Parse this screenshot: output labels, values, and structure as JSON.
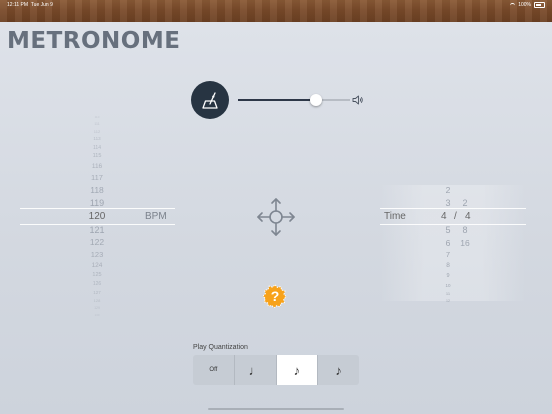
{
  "status_bar": {
    "time": "12:11 PM",
    "date": "Tue Jun 9",
    "battery": "100%"
  },
  "app": {
    "title": "METRONOME"
  },
  "volume": {
    "level": 0.7
  },
  "bpm_picker": {
    "values_above": [
      "110",
      "111",
      "112",
      "113",
      "114",
      "115",
      "116",
      "117",
      "118",
      "119"
    ],
    "selected": "120",
    "values_below": [
      "121",
      "122",
      "123",
      "124",
      "125",
      "126",
      "127",
      "128",
      "129",
      "130"
    ],
    "unit": "BPM"
  },
  "time_signature": {
    "label": "Time",
    "beats_above": [
      "2",
      "3"
    ],
    "beats_selected": "4",
    "beats_below": [
      "5",
      "6",
      "7",
      "8",
      "9",
      "10",
      "11",
      "12"
    ],
    "separator": "/",
    "note_above": [
      "2"
    ],
    "note_selected": "4",
    "note_below": [
      "8",
      "16"
    ]
  },
  "help": {
    "label": "?",
    "color": "#f7a21b"
  },
  "quantization": {
    "label": "Play Quantization",
    "options": [
      {
        "label": "Off",
        "icon": "off"
      },
      {
        "label": "♩",
        "icon": "quarter-note-icon"
      },
      {
        "label": "♪",
        "icon": "eighth-note-icon"
      },
      {
        "label": "♪",
        "icon": "sixteenth-note-icon"
      }
    ],
    "selected_index": 2
  },
  "colors": {
    "title": "#67707d",
    "metro_button": "#273442",
    "accent": "#f7a21b"
  }
}
